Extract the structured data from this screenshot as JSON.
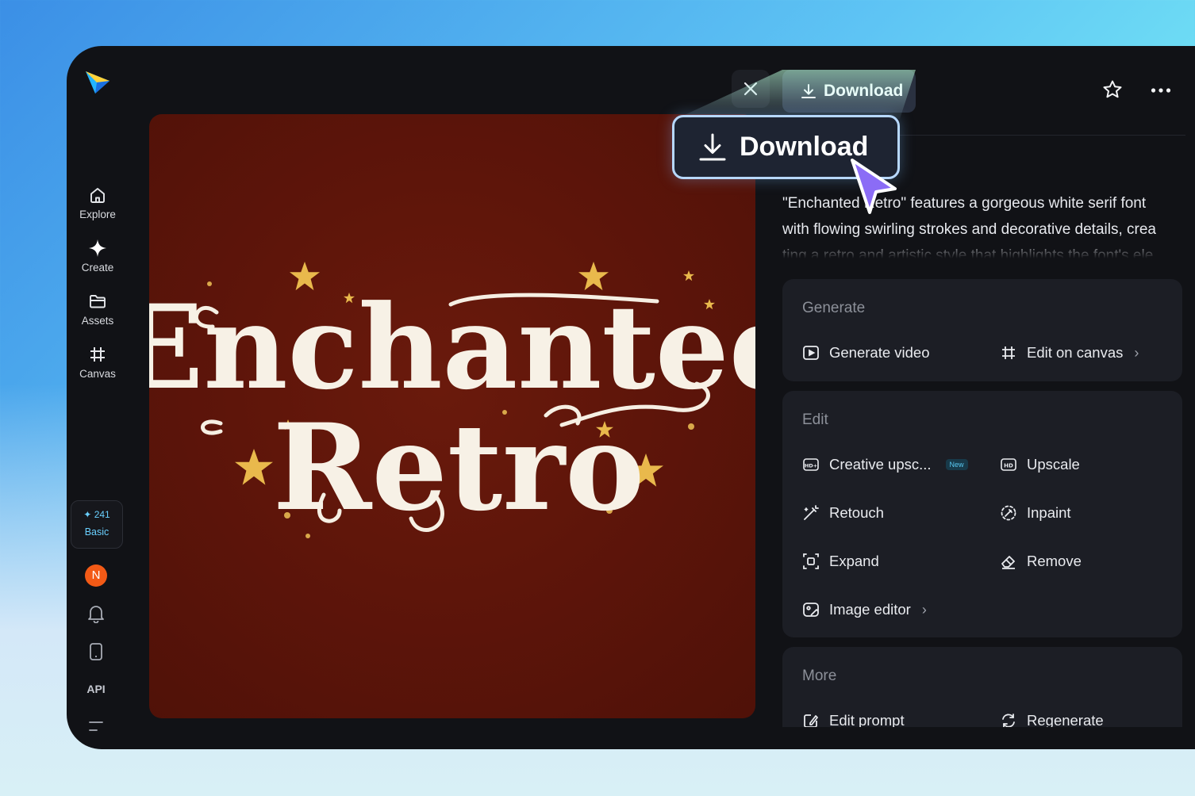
{
  "sidebar": {
    "items": [
      {
        "label": "Explore",
        "icon": "home-icon"
      },
      {
        "label": "Create",
        "icon": "sparkle-icon"
      },
      {
        "label": "Assets",
        "icon": "folder-icon"
      },
      {
        "label": "Canvas",
        "icon": "canvas-icon"
      }
    ],
    "credits": {
      "count": "241",
      "plan": "Basic"
    },
    "avatar_initial": "N",
    "api_label": "API"
  },
  "toolbar": {
    "download_small": "Download",
    "download_big": "Download"
  },
  "image": {
    "line1": "Enchanted",
    "line2": "Retro"
  },
  "description": {
    "line1": "\"Enchanted Retro\" features a gorgeous white serif font",
    "line2": "with flowing swirling strokes and decorative details, crea",
    "line3": "ting a retro and artistic style that highlights the font's ele"
  },
  "panels": {
    "generate": {
      "title": "Generate",
      "generate_video": "Generate video",
      "edit_on_canvas": "Edit on canvas"
    },
    "edit": {
      "title": "Edit",
      "creative_upscale": "Creative upsc...",
      "new_badge": "New",
      "upscale": "Upscale",
      "retouch": "Retouch",
      "inpaint": "Inpaint",
      "expand": "Expand",
      "remove": "Remove",
      "image_editor": "Image editor"
    },
    "more": {
      "title": "More",
      "edit_prompt": "Edit prompt",
      "regenerate": "Regenerate"
    }
  },
  "colors": {
    "accent": "#6ad0ff",
    "avatar": "#f35a16",
    "image_bg": "#5e150a",
    "cursor": "#8b6cf6"
  }
}
